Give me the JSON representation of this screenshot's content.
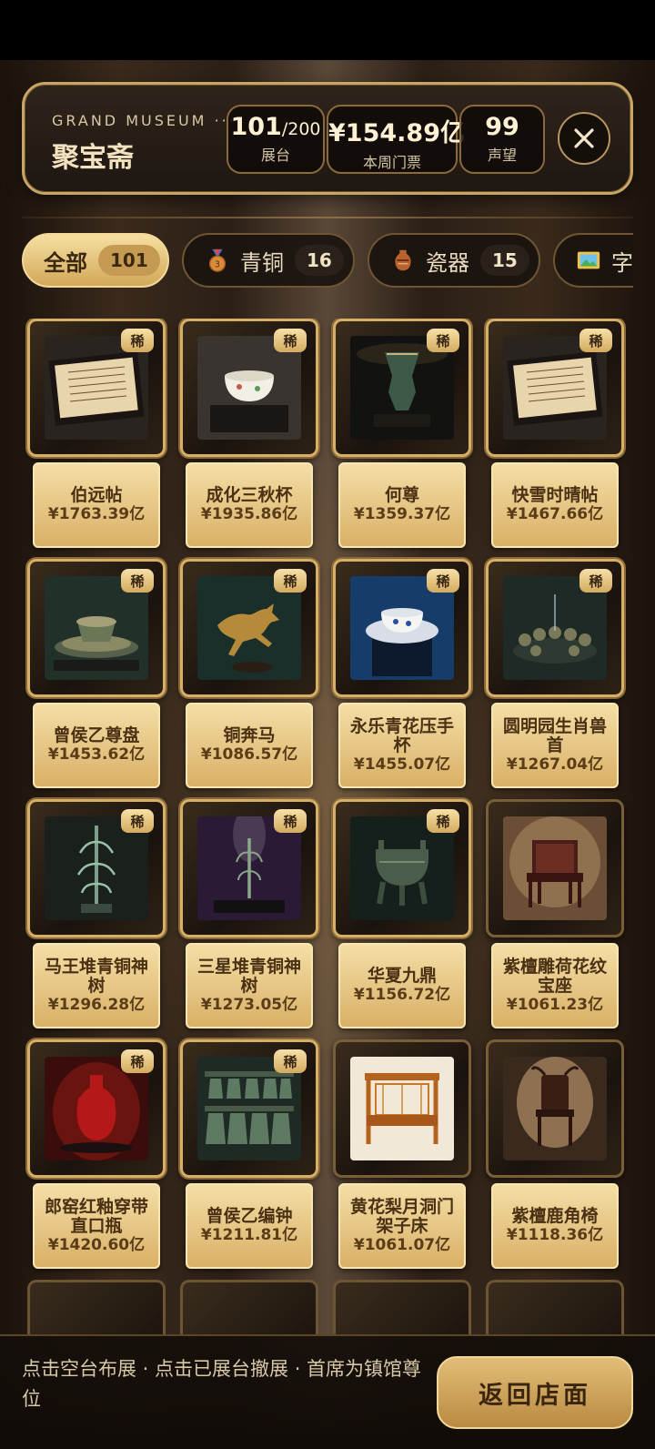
{
  "header": {
    "brand_sub": "GRAND MUSEUM ···",
    "title": "聚宝斋",
    "stats": [
      {
        "value": "101",
        "suffix": "/200",
        "label": "展台"
      },
      {
        "value": "¥154.89亿",
        "suffix": "",
        "label": "本周门票"
      },
      {
        "value": "99",
        "suffix": "",
        "label": "声望"
      }
    ]
  },
  "tabs": [
    {
      "label": "全部",
      "count": "101",
      "icon": "",
      "active": true
    },
    {
      "label": "青铜",
      "count": "16",
      "icon": "bronze-medal-icon"
    },
    {
      "label": "瓷器",
      "count": "15",
      "icon": "vase-icon"
    },
    {
      "label": "字",
      "count": "",
      "icon": "painting-icon"
    }
  ],
  "badge_label": "稀",
  "items": [
    {
      "name": "伯远帖",
      "price": "¥1763.39亿",
      "rare": true,
      "art": "scroll"
    },
    {
      "name": "成化三秋杯",
      "price": "¥1935.86亿",
      "rare": true,
      "art": "cup"
    },
    {
      "name": "何尊",
      "price": "¥1359.37亿",
      "rare": true,
      "art": "zun"
    },
    {
      "name": "快雪时晴帖",
      "price": "¥1467.66亿",
      "rare": true,
      "art": "scroll"
    },
    {
      "name": "曾侯乙尊盘",
      "price": "¥1453.62亿",
      "rare": true,
      "art": "plate"
    },
    {
      "name": "铜奔马",
      "price": "¥1086.57亿",
      "rare": true,
      "art": "horse"
    },
    {
      "name": "永乐青花压手杯",
      "price": "¥1455.07亿",
      "rare": true,
      "art": "bowl"
    },
    {
      "name": "圆明园生肖兽首",
      "price": "¥1267.04亿",
      "rare": true,
      "art": "heads"
    },
    {
      "name": "马王堆青铜神树",
      "price": "¥1296.28亿",
      "rare": true,
      "art": "tree"
    },
    {
      "name": "三星堆青铜神树",
      "price": "¥1273.05亿",
      "rare": true,
      "art": "tree2"
    },
    {
      "name": "华夏九鼎",
      "price": "¥1156.72亿",
      "rare": true,
      "art": "ding"
    },
    {
      "name": "紫檀雕荷花纹宝座",
      "price": "¥1061.23亿",
      "rare": false,
      "art": "throne"
    },
    {
      "name": "郎窑红釉穿带直口瓶",
      "price": "¥1420.60亿",
      "rare": true,
      "art": "redvase"
    },
    {
      "name": "曾侯乙编钟",
      "price": "¥1211.81亿",
      "rare": true,
      "art": "bells"
    },
    {
      "name": "黄花梨月洞门架子床",
      "price": "¥1061.07亿",
      "rare": false,
      "art": "bed"
    },
    {
      "name": "紫檀鹿角椅",
      "price": "¥1118.36亿",
      "rare": false,
      "art": "chair"
    }
  ],
  "footer": {
    "hint": "点击空台布展 · 点击已展台撤展 · 首席为镇馆尊位",
    "back_label": "返回店面"
  }
}
